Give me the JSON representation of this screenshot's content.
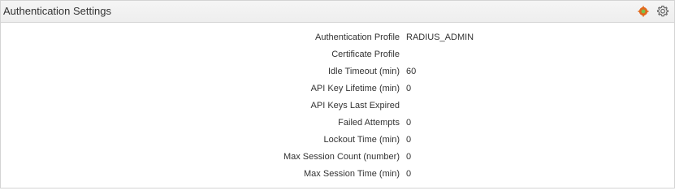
{
  "panel": {
    "title": "Authentication Settings",
    "icons": [
      {
        "name": "status-icon",
        "color": "#e2691d"
      },
      {
        "name": "gear-icon",
        "color": "#666666"
      }
    ]
  },
  "settings": [
    {
      "label": "Authentication Profile",
      "value": "RADIUS_ADMIN"
    },
    {
      "label": "Certificate Profile",
      "value": ""
    },
    {
      "label": "Idle Timeout (min)",
      "value": "60"
    },
    {
      "label": "API Key Lifetime (min)",
      "value": "0"
    },
    {
      "label": "API Keys Last Expired",
      "value": ""
    },
    {
      "label": "Failed Attempts",
      "value": "0"
    },
    {
      "label": "Lockout Time (min)",
      "value": "0"
    },
    {
      "label": "Max Session Count (number)",
      "value": "0"
    },
    {
      "label": "Max Session Time (min)",
      "value": "0"
    }
  ]
}
